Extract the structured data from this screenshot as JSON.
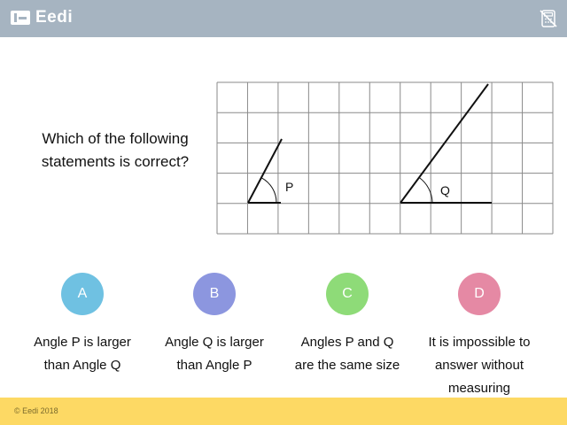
{
  "header": {
    "brand_name": "Eedi",
    "calculator_icon": "calculator-crossed-icon",
    "background_color": "#a6b4c1"
  },
  "question": {
    "text": "Which of the following statements is correct?"
  },
  "diagram": {
    "grid_cols": 11,
    "grid_rows": 5,
    "angle_p_label": "P",
    "angle_q_label": "Q"
  },
  "options": [
    {
      "letter": "A",
      "text": "Angle P is larger than Angle Q",
      "color": "#6fc1e2"
    },
    {
      "letter": "B",
      "text": "Angle Q is larger than Angle P",
      "color": "#8c96df"
    },
    {
      "letter": "C",
      "text": "Angles P and Q are the same size",
      "color": "#8edb78"
    },
    {
      "letter": "D",
      "text": "It is impossible to answer without measuring",
      "color": "#e589a4"
    }
  ],
  "footer": {
    "copyright": "© Eedi 2018",
    "background_color": "#fdd964"
  }
}
